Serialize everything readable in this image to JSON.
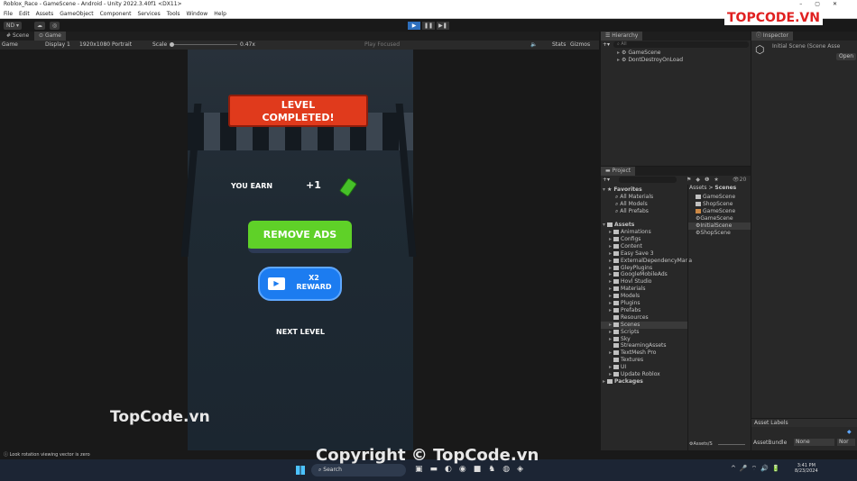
{
  "window": {
    "title": "Roblox_Race - GameScene - Android - Unity 2022.3.40f1 <DX11>"
  },
  "menu": [
    "File",
    "Edit",
    "Assets",
    "GameObject",
    "Component",
    "Services",
    "Tools",
    "Window",
    "Help"
  ],
  "toolbar": {
    "account": "ND ▾",
    "play": "▶",
    "pause": "❚❚",
    "step": "▶❚"
  },
  "tabs": {
    "scene": "Scene",
    "game": "Game"
  },
  "game_toolbar": {
    "mode": "Game",
    "display": "Display 1",
    "resolution": "1920x1080 Portrait",
    "scale_label": "Scale",
    "scale_value": "0.47x",
    "play_focused": "Play Focused",
    "stats": "Stats",
    "gizmos": "Gizmos"
  },
  "game": {
    "title_line1": "LEVEL",
    "title_line2": "COMPLETED!",
    "you_earn": "YOU EARN",
    "earn_amount": "+1",
    "remove_ads": "REMOVE ADS",
    "reward_line1": "X2",
    "reward_line2": "REWARD",
    "next_level": "NEXT LEVEL"
  },
  "hierarchy": {
    "title": "Hierarchy",
    "search_placeholder": "All",
    "items": [
      "GameScene",
      "DontDestroyOnLoad"
    ]
  },
  "project": {
    "title": "Project",
    "count": "20",
    "favorites_label": "Favorites",
    "favorites": [
      "All Materials",
      "All Models",
      "All Prefabs"
    ],
    "assets_label": "Assets",
    "folders": [
      "Animations",
      "Configs",
      "Content",
      "Easy Save 3",
      "ExternalDependencyMana",
      "GleyPlugins",
      "GoogleMobileAds",
      "Hovl Studio",
      "Materials",
      "Models",
      "Plugins",
      "Prefabs",
      "Resources",
      "Scenes",
      "Scripts",
      "Sky",
      "StreamingAssets",
      "TextMesh Pro",
      "Textures",
      "UI",
      "Update Roblox"
    ],
    "selected_folder": "Scenes",
    "packages_label": "Packages",
    "breadcrumb": [
      "Assets",
      "Scenes"
    ],
    "files": [
      "GameScene",
      "ShopScene",
      "GameScene",
      "GameScene",
      "InitialScene",
      "ShopScene"
    ],
    "selected_file": "InitialScene",
    "footer_path": "Assets/S"
  },
  "inspector": {
    "title": "Inspector",
    "object": "Initial Scene (Scene Asse",
    "open": "Open",
    "asset_labels": "Asset Labels",
    "asset_bundle_label": "AssetBundle",
    "asset_bundle_value": "None",
    "asset_bundle_variant": "Nor"
  },
  "status": {
    "message": "Look rotation viewing vector is zero"
  },
  "taskbar": {
    "search": "Search",
    "time": "3:41 PM",
    "date": "8/23/2024"
  },
  "watermarks": {
    "logo": "TOPCODE.VN",
    "mid": "TopCode.vn",
    "copyright": "Copyright © TopCode.vn"
  },
  "colors": {
    "accent": "#2e6fbd",
    "ribbon": "#e03a1c",
    "green_button": "#5fd128",
    "blue_button": "#1c7cf0"
  }
}
